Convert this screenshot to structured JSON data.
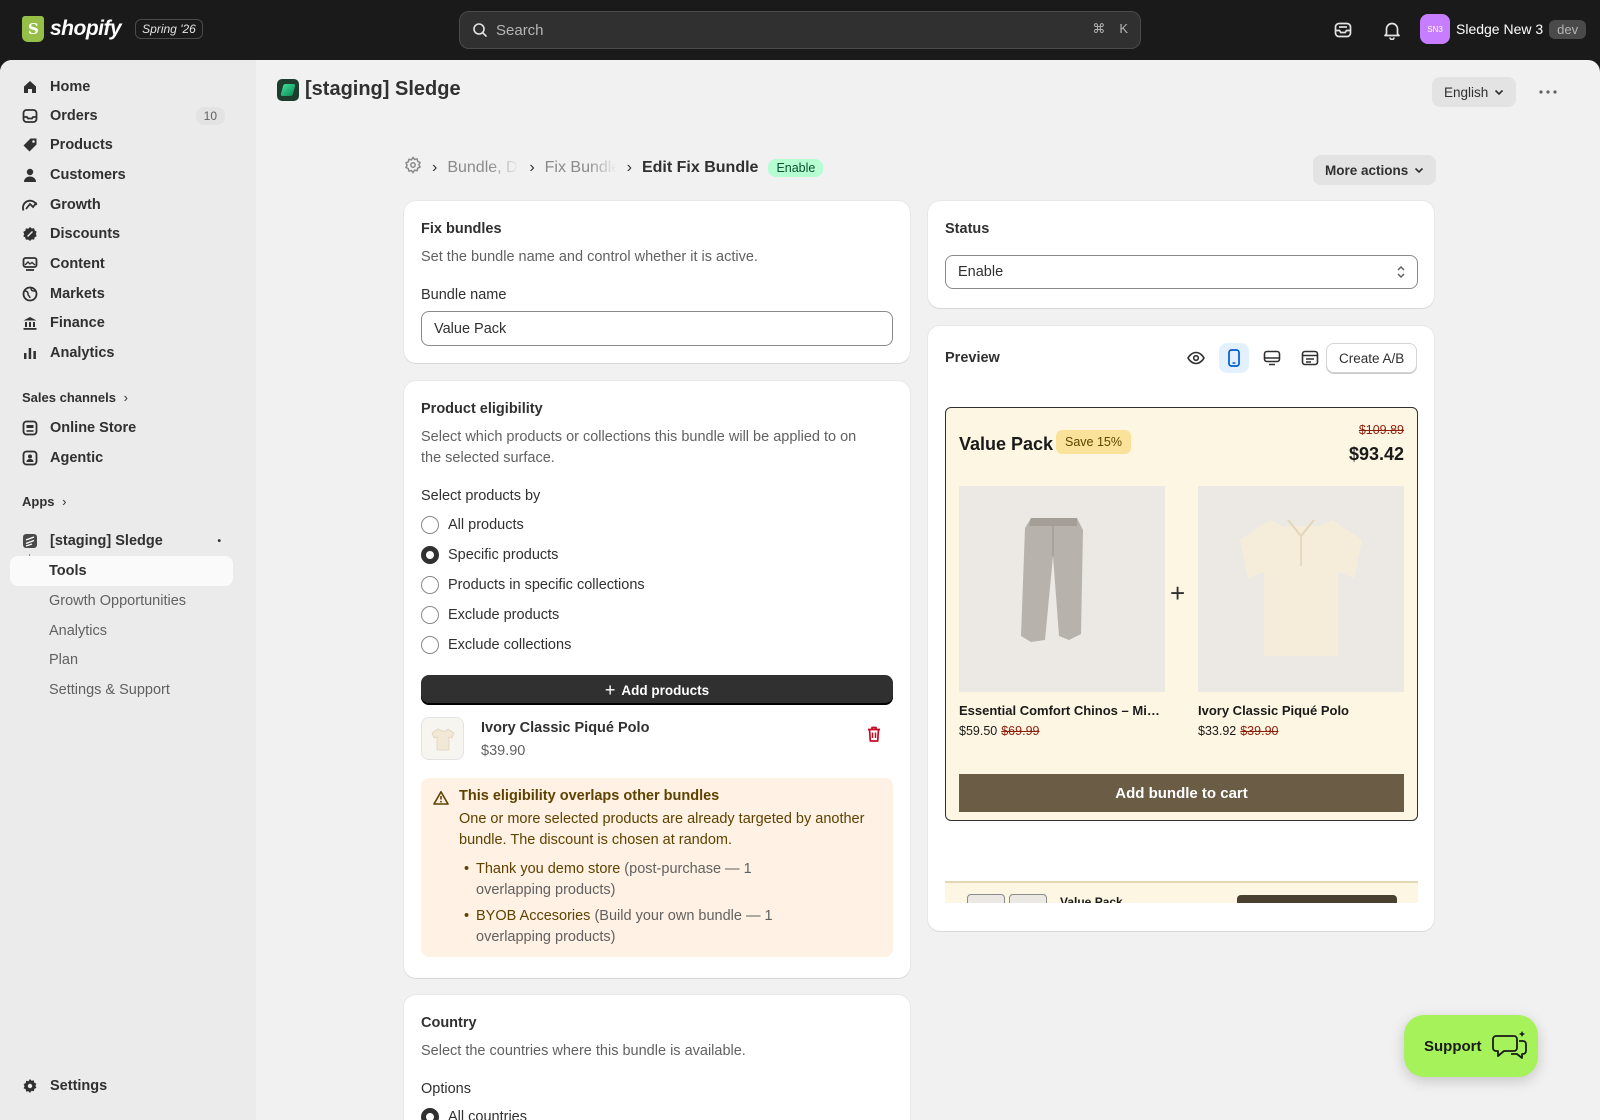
{
  "topbar": {
    "logo_text": "shopify",
    "edition": "Spring '26",
    "search_placeholder": "Search",
    "shortcut_cmd": "⌘",
    "shortcut_key": "K",
    "user_initials": "SN3",
    "user_name": "Sledge New 3",
    "user_badge": "dev"
  },
  "sidebar": {
    "items": [
      {
        "label": "Home",
        "icon": "home-icon"
      },
      {
        "label": "Orders",
        "icon": "orders-icon",
        "badge": "10"
      },
      {
        "label": "Products",
        "icon": "tag-icon"
      },
      {
        "label": "Customers",
        "icon": "person-icon"
      },
      {
        "label": "Growth",
        "icon": "growth-icon"
      },
      {
        "label": "Discounts",
        "icon": "discount-icon"
      },
      {
        "label": "Content",
        "icon": "content-icon"
      },
      {
        "label": "Markets",
        "icon": "globe-icon"
      },
      {
        "label": "Finance",
        "icon": "bank-icon"
      },
      {
        "label": "Analytics",
        "icon": "bar-chart-icon"
      }
    ],
    "sales_channels_label": "Sales channels",
    "channels": [
      {
        "label": "Online Store",
        "icon": "store-icon"
      },
      {
        "label": "Agentic",
        "icon": "agentic-icon"
      }
    ],
    "apps_label": "Apps",
    "app_name": "[staging] Sledge",
    "app_subitems": [
      {
        "label": "Tools",
        "active": true
      },
      {
        "label": "Growth Opportunities",
        "active": false
      },
      {
        "label": "Analytics",
        "active": false
      },
      {
        "label": "Plan",
        "active": false
      },
      {
        "label": "Settings & Support",
        "active": false
      }
    ],
    "settings_label": "Settings"
  },
  "header": {
    "app_title": "[staging] Sledge",
    "language": "English"
  },
  "breadcrumb": {
    "items": [
      "Bundle, Discounts",
      "Fix Bundles"
    ],
    "current": "Edit Fix Bundle",
    "status_badge": "Enable",
    "more_actions": "More actions"
  },
  "fix_bundles": {
    "title": "Fix bundles",
    "description": "Set the bundle name and control whether it is active.",
    "name_label": "Bundle name",
    "name_value": "Value Pack"
  },
  "eligibility": {
    "title": "Product eligibility",
    "description_line1": "Select which products or collections this bundle will be applied to on",
    "description_line2": "the selected surface.",
    "select_by_label": "Select products by",
    "options": [
      {
        "label": "All products",
        "checked": false
      },
      {
        "label": "Specific products",
        "checked": true
      },
      {
        "label": "Products in specific collections",
        "checked": false
      },
      {
        "label": "Exclude products",
        "checked": false
      },
      {
        "label": "Exclude collections",
        "checked": false
      }
    ],
    "add_button": "Add products",
    "product": {
      "name": "Ivory Classic Piqué Polo",
      "price": "$39.90"
    },
    "warning": {
      "title": "This eligibility overlaps other bundles",
      "body_line1": "One or more selected products are already targeted by another",
      "body_line2": "bundle. The discount is chosen at random.",
      "items": [
        {
          "link": "Thank you demo store",
          "detail1": " (post-purchase — 1",
          "detail2": "overlapping products)"
        },
        {
          "link": "BYOB Accesories",
          "detail1": " (Build your own bundle — 1",
          "detail2": "overlapping products)"
        }
      ]
    }
  },
  "country": {
    "title": "Country",
    "description": "Select the countries where this bundle is available.",
    "options_label": "Options",
    "first_option": "All countries"
  },
  "status": {
    "title": "Status",
    "value": "Enable"
  },
  "preview": {
    "title": "Preview",
    "create_ab": "Create A/B",
    "bundle": {
      "title": "Value Pack",
      "save_badge": "Save 15%",
      "old_total": "$109.89",
      "new_total": "$93.42",
      "products": [
        {
          "name": "Essential Comfort Chinos – Mist Grey",
          "price": "$59.50",
          "old_price": "$69.99"
        },
        {
          "name": "Ivory Classic Piqué Polo",
          "price": "$33.92",
          "old_price": "$39.90"
        }
      ],
      "cart_button": "Add bundle to cart",
      "strip_title": "Value Pack"
    }
  },
  "support_button": "Support",
  "colors": {
    "accent_green": "#a6f25a",
    "badge_green": "#b4fed2",
    "warning_bg": "#fff1e3",
    "bundle_bg": "#fdf6e3",
    "cart_button": "#6b5d45"
  }
}
